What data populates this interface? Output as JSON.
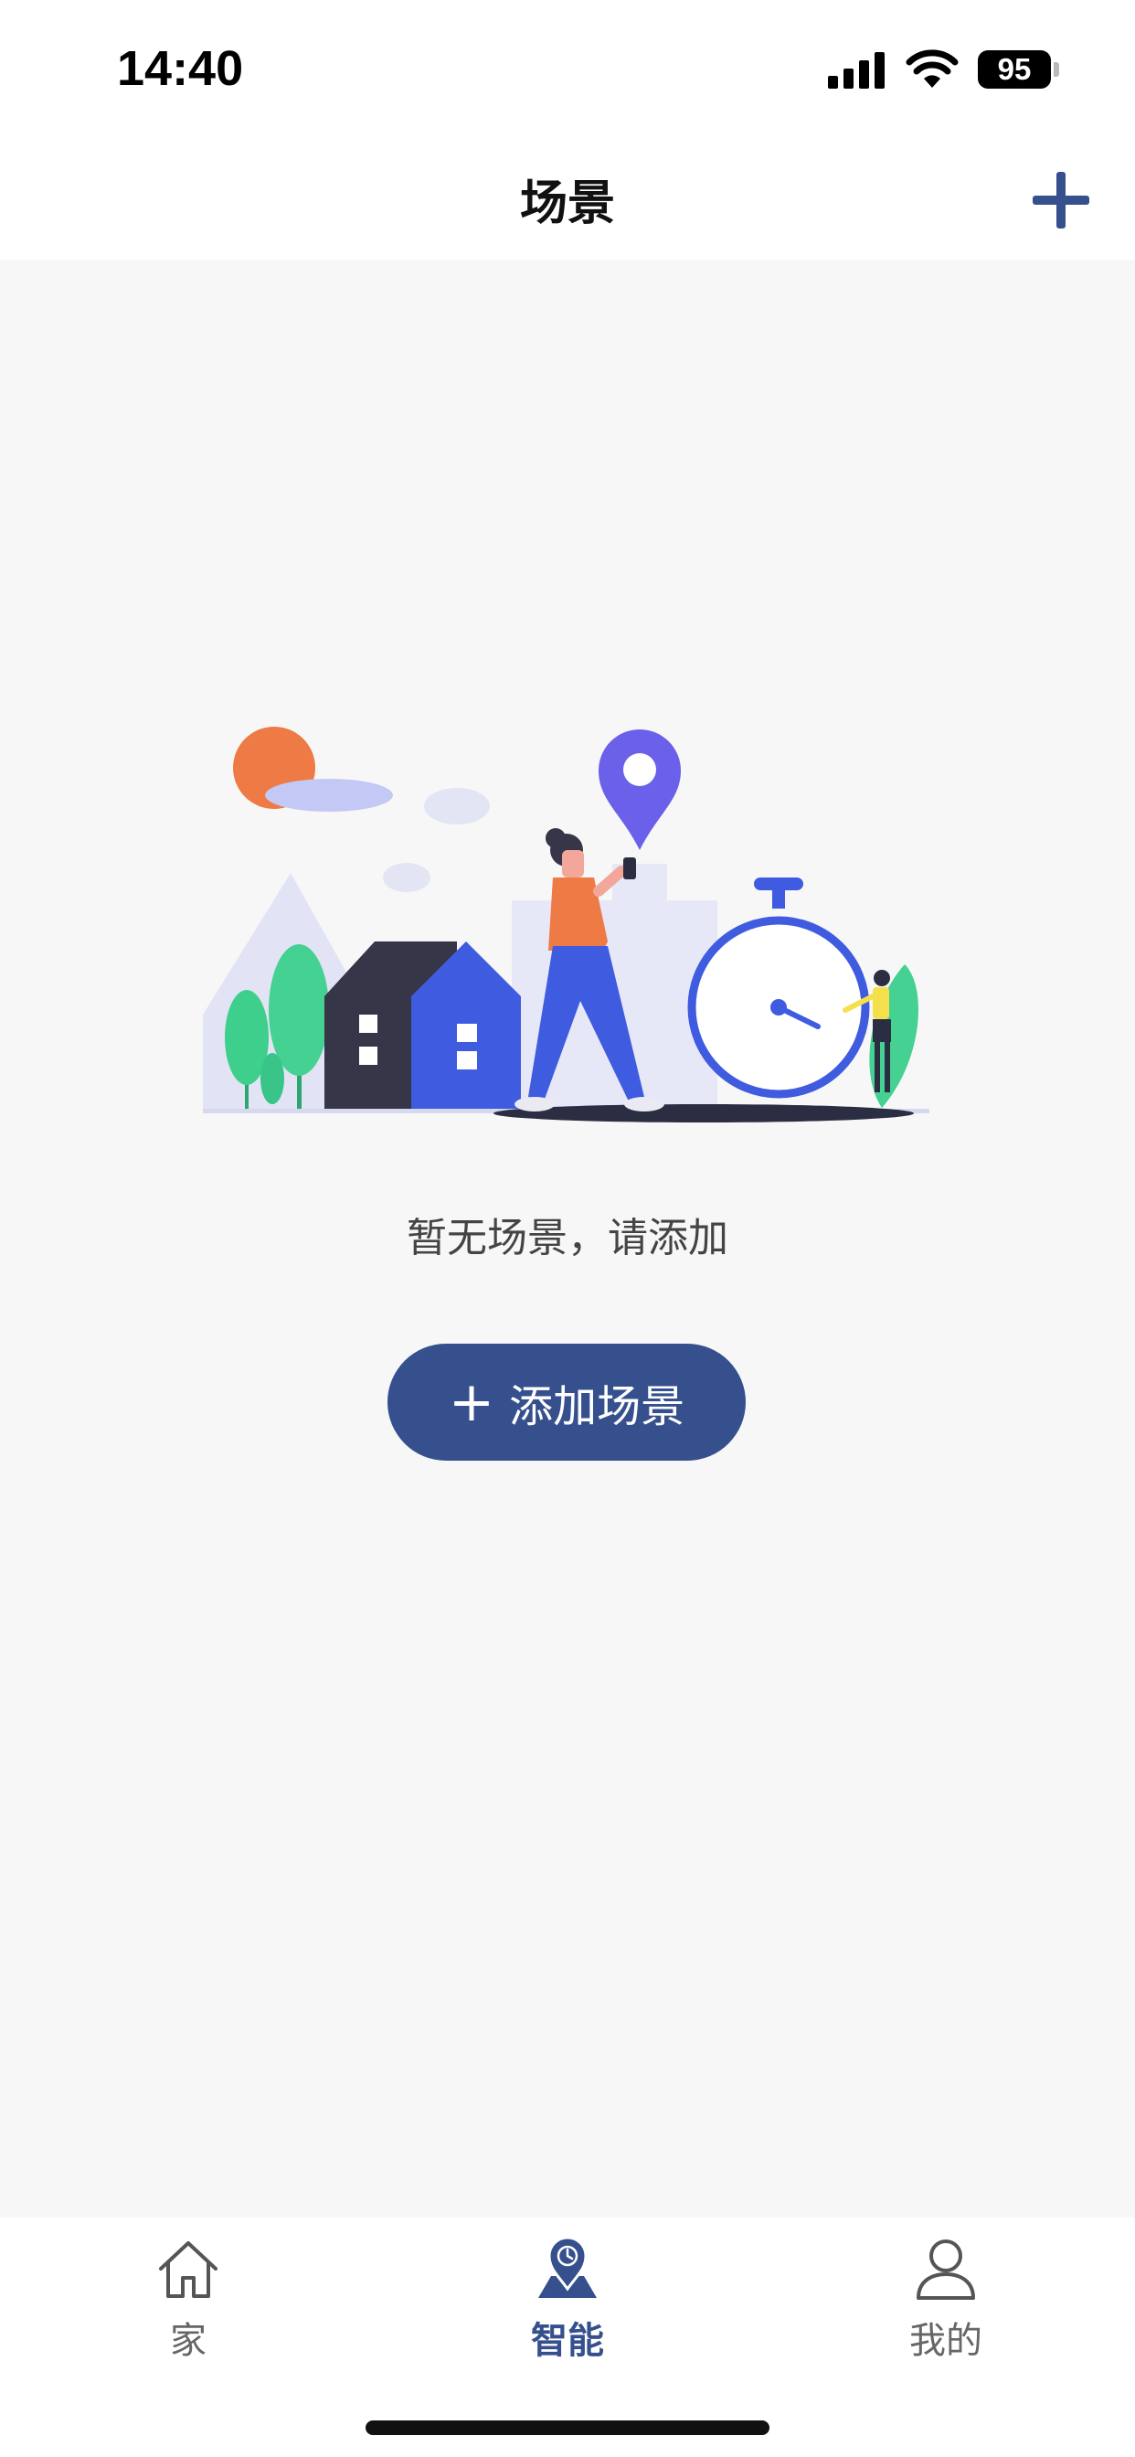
{
  "status_bar": {
    "time": "14:40",
    "battery": "95"
  },
  "header": {
    "title": "场景"
  },
  "empty_state": {
    "message": "暂无场景，请添加",
    "add_button_icon": "+",
    "add_button_label": "添加场景"
  },
  "tabs": [
    {
      "label": "家",
      "icon": "home-icon",
      "active": false
    },
    {
      "label": "智能",
      "icon": "smart-location-icon",
      "active": true
    },
    {
      "label": "我的",
      "icon": "profile-icon",
      "active": false
    }
  ],
  "colors": {
    "accent": "#36508e",
    "background": "#f7f7f7"
  }
}
